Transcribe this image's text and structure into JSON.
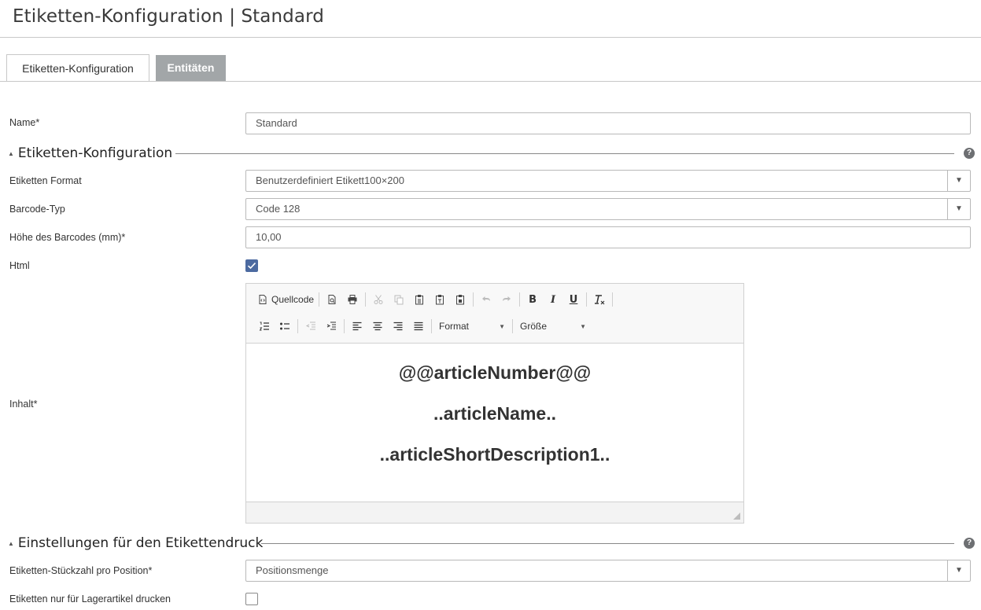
{
  "header": {
    "title": "Etiketten-Konfiguration | Standard"
  },
  "tabs": [
    {
      "label": "Etiketten-Konfiguration",
      "active": true
    },
    {
      "label": "Entitäten",
      "active": false
    }
  ],
  "form": {
    "name": {
      "label": "Name*",
      "value": "Standard"
    },
    "section_config": {
      "title": "Etiketten-Konfiguration",
      "help": "?"
    },
    "label_format": {
      "label": "Etiketten Format",
      "value": "Benutzerdefiniert Etikett100×200"
    },
    "barcode_type": {
      "label": "Barcode-Typ",
      "value": "Code 128"
    },
    "barcode_height": {
      "label": "Höhe des Barcodes (mm)*",
      "value": "10,00"
    },
    "html": {
      "label": "Html",
      "checked": true
    },
    "content": {
      "label": "Inhalt*",
      "toolbar": {
        "source_label": "Quellcode",
        "format_label": "Format",
        "size_label": "Größe"
      },
      "lines": [
        "@@articleNumber@@",
        "..articleName..",
        "..articleShortDescription1.."
      ]
    },
    "section_print": {
      "title": "Einstellungen für den Etikettendruck",
      "help": "?"
    },
    "qty_per_position": {
      "label": "Etiketten-Stückzahl pro Position*",
      "value": "Positionsmenge"
    },
    "stock_only": {
      "label": "Etiketten nur für Lagerartikel drucken",
      "checked": false
    }
  },
  "icons": {
    "dropdown": "chevron-down-icon",
    "check": "checkmark-icon",
    "help": "question-circle-icon"
  },
  "colors": {
    "tab_inactive_bg": "#a2a6a8",
    "checkbox_checked": "#4c6aa0",
    "help_icon": "#6d6f72"
  }
}
